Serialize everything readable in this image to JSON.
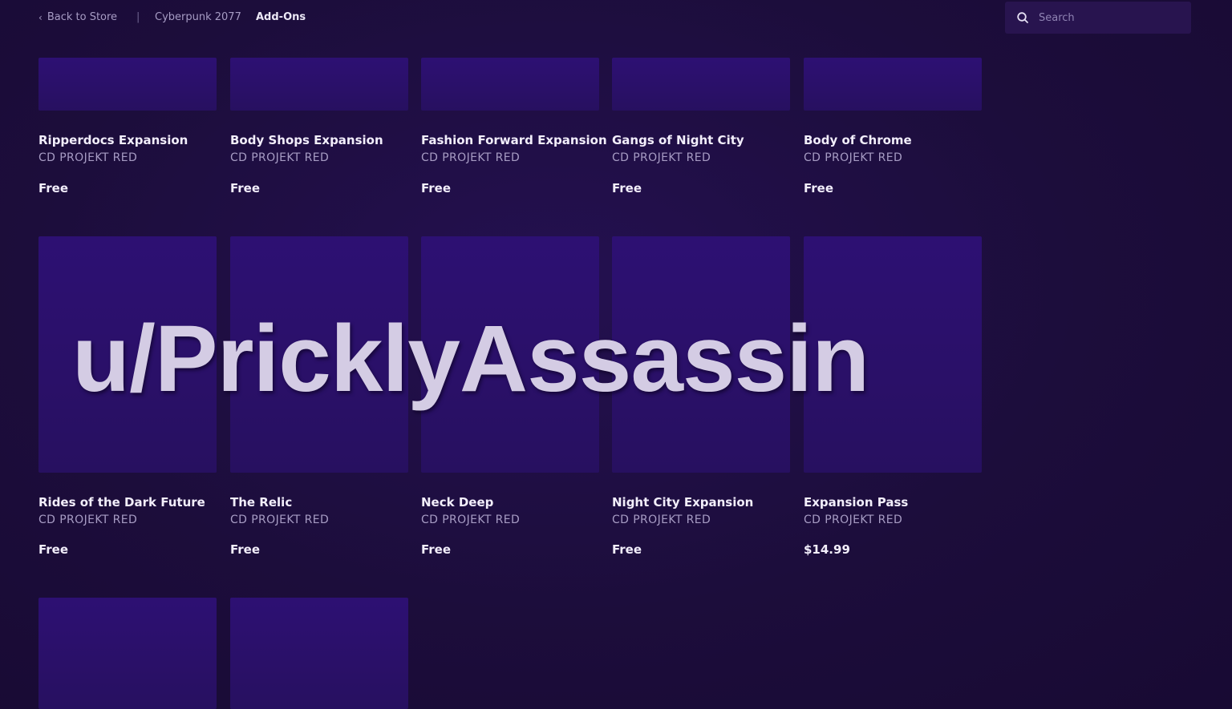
{
  "nav": {
    "back_label": "Back to Store",
    "separator": "|",
    "game_label": "Cyberpunk 2077",
    "active_label": "Add-Ons"
  },
  "search": {
    "placeholder": "Search",
    "value": ""
  },
  "rows": [
    {
      "items": [
        {
          "title": "Ripperdocs Expansion",
          "developer": "CD PROJEKT RED",
          "price": "Free"
        },
        {
          "title": "Body Shops Expansion",
          "developer": "CD PROJEKT RED",
          "price": "Free"
        },
        {
          "title": "Fashion Forward Expansion",
          "developer": "CD PROJEKT RED",
          "price": "Free"
        },
        {
          "title": "Gangs of Night City",
          "developer": "CD PROJEKT RED",
          "price": "Free"
        },
        {
          "title": "Body of Chrome",
          "developer": "CD PROJEKT RED",
          "price": "Free"
        }
      ]
    },
    {
      "items": [
        {
          "title": "Rides of the Dark Future",
          "developer": "CD PROJEKT RED",
          "price": "Free"
        },
        {
          "title": "The Relic",
          "developer": "CD PROJEKT RED",
          "price": "Free"
        },
        {
          "title": "Neck Deep",
          "developer": "CD PROJEKT RED",
          "price": "Free"
        },
        {
          "title": "Night City Expansion",
          "developer": "CD PROJEKT RED",
          "price": "Free"
        },
        {
          "title": "Expansion Pass",
          "developer": "CD PROJEKT RED",
          "price": "$14.99"
        }
      ]
    }
  ],
  "watermark": "u/PricklyAssassin",
  "colors": {
    "background": "#1c0d3b",
    "thumbnail": "#2b106c",
    "text_primary": "#f2eefb",
    "text_secondary": "#a79cc4"
  }
}
